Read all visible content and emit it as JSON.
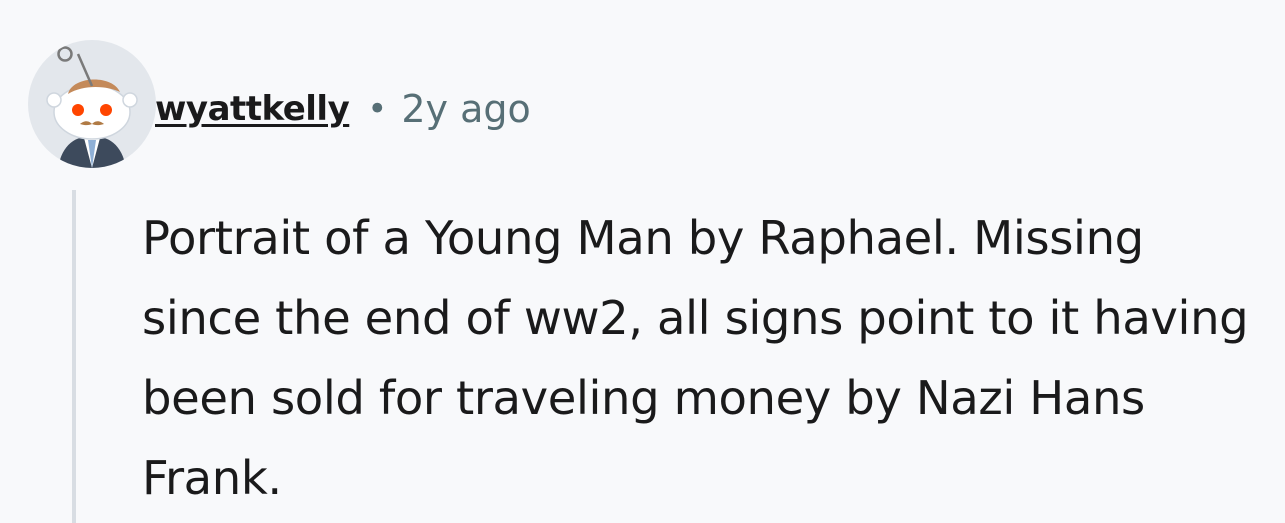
{
  "comment": {
    "author": "wyattkelly",
    "separator": "•",
    "timestamp": "2y ago",
    "body": "Portrait of a Young Man by Raphael. Missing since the end of ww2, all signs point to it having been sold for traveling money by Nazi Hans Frank.",
    "avatar_icon": "reddit-snoo-avatar-icon"
  },
  "colors": {
    "background": "#f8f9fb",
    "username": "#1a1a1b",
    "timestamp": "#576f76",
    "thread_line": "#d8dde3"
  }
}
